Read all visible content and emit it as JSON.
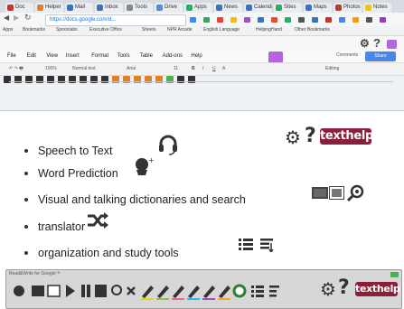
{
  "browser": {
    "tabs": [
      {
        "label": "Doc",
        "color": "#c0392b"
      },
      {
        "label": "Helper",
        "color": "#e67e22"
      },
      {
        "label": "Mail",
        "color": "#3b73c4"
      },
      {
        "label": "Inbox",
        "color": "#3b73c4"
      },
      {
        "label": "Tools",
        "color": "#7f8c8d"
      },
      {
        "label": "Drive",
        "color": "#4a90e2"
      },
      {
        "label": "Apps",
        "color": "#27ae60"
      },
      {
        "label": "News",
        "color": "#3b73c4"
      },
      {
        "label": "Calendar",
        "color": "#3b73c4"
      },
      {
        "label": "Sites",
        "color": "#27ae60"
      },
      {
        "label": "Maps",
        "color": "#3b73c4"
      },
      {
        "label": "Photos",
        "color": "#c0392b"
      },
      {
        "label": "Notes",
        "color": "#f1c40f"
      }
    ],
    "url": "https://docs.google.com/d...",
    "bookmarks": [
      "Apps",
      "Bookmarks",
      "Spoonlabs",
      "Executive Office",
      "Sheets",
      "NPR Arcade",
      "English Language",
      "HelpingHand",
      "Other Bookmarks"
    ]
  },
  "doc": {
    "menus": [
      "File",
      "Edit",
      "View",
      "Insert",
      "Format",
      "Tools",
      "Table",
      "Add-ons",
      "Help"
    ],
    "format": {
      "zoom": "100%",
      "style": "Normal text",
      "font": "Arial",
      "size": "11",
      "editing": "Editing"
    },
    "comments_label": "Comments",
    "share_label": "Share"
  },
  "features": [
    {
      "text": "Speech to Text"
    },
    {
      "text": "Word Prediction"
    },
    {
      "text": "Visual and talking dictionaries and search"
    },
    {
      "text": "translator"
    },
    {
      "text": "organization and study tools"
    }
  ],
  "brand": {
    "badge": "texthelp",
    "question": "?"
  },
  "toolbar": {
    "title": "Read&Write for Google™",
    "question": "?",
    "badge": "texthelp"
  },
  "colors": {
    "accent_blue": "#4a86e8",
    "brand": "#8a1f3a",
    "purple": "#b066e0",
    "icon_dark": "#333333"
  }
}
